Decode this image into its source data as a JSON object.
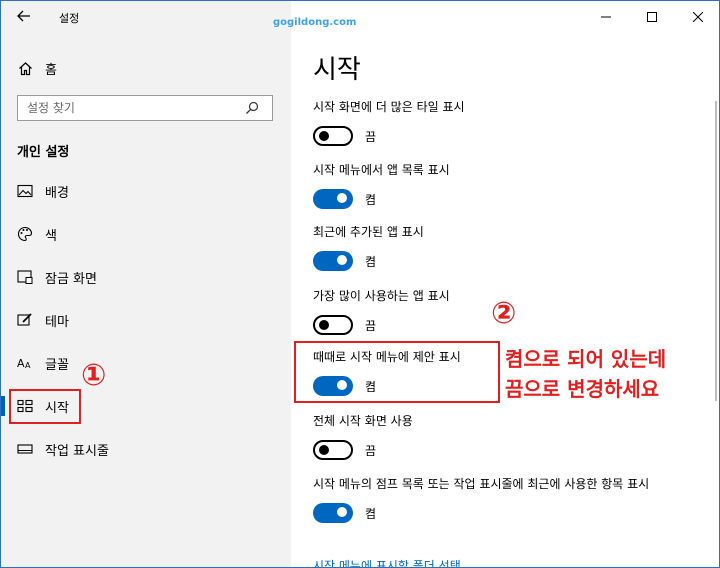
{
  "window": {
    "title": "설정",
    "back_icon": "back-arrow-icon"
  },
  "watermark": "gogildong.com",
  "controls": {
    "minimize": "minimize-icon",
    "maximize": "maximize-icon",
    "close": "close-icon"
  },
  "sidebar": {
    "home_label": "홈",
    "search_placeholder": "설정 찾기",
    "section_title": "개인 설정",
    "items": [
      {
        "label": "배경",
        "icon": "picture-icon"
      },
      {
        "label": "색",
        "icon": "palette-icon"
      },
      {
        "label": "잠금 화면",
        "icon": "lock-screen-icon"
      },
      {
        "label": "테마",
        "icon": "theme-brush-icon"
      },
      {
        "label": "글꼴",
        "icon": "font-icon"
      },
      {
        "label": "시작",
        "icon": "start-menu-icon",
        "active": true
      },
      {
        "label": "작업 표시줄",
        "icon": "taskbar-icon"
      }
    ]
  },
  "main": {
    "title": "시작",
    "settings": [
      {
        "label": "시작 화면에 더 많은 타일 표시",
        "state": "off",
        "state_text": "끔"
      },
      {
        "label": "시작 메뉴에서 앱 목록 표시",
        "state": "on",
        "state_text": "켬"
      },
      {
        "label": "최근에 추가된 앱 표시",
        "state": "on",
        "state_text": "켬"
      },
      {
        "label": "가장 많이 사용하는 앱 표시",
        "state": "off",
        "state_text": "끔"
      },
      {
        "label": "때때로 시작 메뉴에 제안 표시",
        "state": "on",
        "state_text": "켬"
      },
      {
        "label": "전체 시작 화면 사용",
        "state": "off",
        "state_text": "끔"
      },
      {
        "label": "시작 메뉴의 점프 목록 또는 작업 표시줄에 최근에 사용한 항목 표시",
        "state": "on",
        "state_text": "켬"
      }
    ],
    "link": "시작 메뉴에 표시할 폴더 선택"
  },
  "annotations": {
    "num1": "①",
    "num2": "②",
    "line1": "켬으로 되어 있는데",
    "line2": "끔으로 변경하세요",
    "accent": "#e02020"
  }
}
